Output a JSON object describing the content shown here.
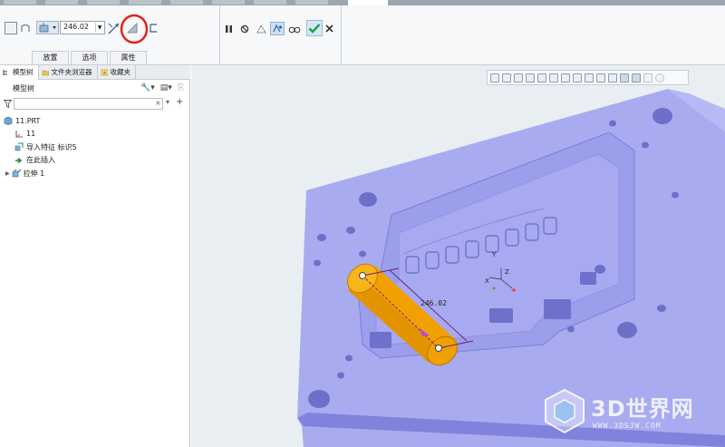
{
  "ribbon": {
    "depth_value": "246.02",
    "tabs": [
      "放置",
      "选项",
      "属性"
    ]
  },
  "panel": {
    "tabs": [
      {
        "label": "模型树",
        "icon": "model-tree-icon"
      },
      {
        "label": "文件夹浏览器",
        "icon": "folder-browser-icon"
      },
      {
        "label": "收藏夹",
        "icon": "favorites-icon"
      }
    ],
    "title": "模型树",
    "filter_placeholder": "",
    "tree": [
      {
        "label": "11.PRT",
        "icon": "part-icon",
        "indent": 0,
        "expander": false
      },
      {
        "label": "11",
        "icon": "csys-icon",
        "indent": 1,
        "expander": false
      },
      {
        "label": "导入特征 标识5",
        "icon": "import-feature-icon",
        "indent": 1,
        "expander": false
      },
      {
        "label": "在此插入",
        "icon": "insert-here-arrow-icon",
        "indent": 1,
        "expander": false
      },
      {
        "label": "拉伸 1",
        "icon": "extrude-icon",
        "indent": 1,
        "expander": true
      }
    ]
  },
  "viewport": {
    "dimension_label": "246.02",
    "axis_labels": [
      "Y",
      "Z",
      "X"
    ]
  },
  "watermark": {
    "title": "3D世界网",
    "url": "WWW.3DSJW.COM"
  },
  "colors": {
    "model": "#a7a9ef",
    "model_dark": "#7d80d9",
    "cylinder": "#f5a300",
    "highlight_circle": "#e2231a",
    "confirm": "#1b9e4b"
  }
}
